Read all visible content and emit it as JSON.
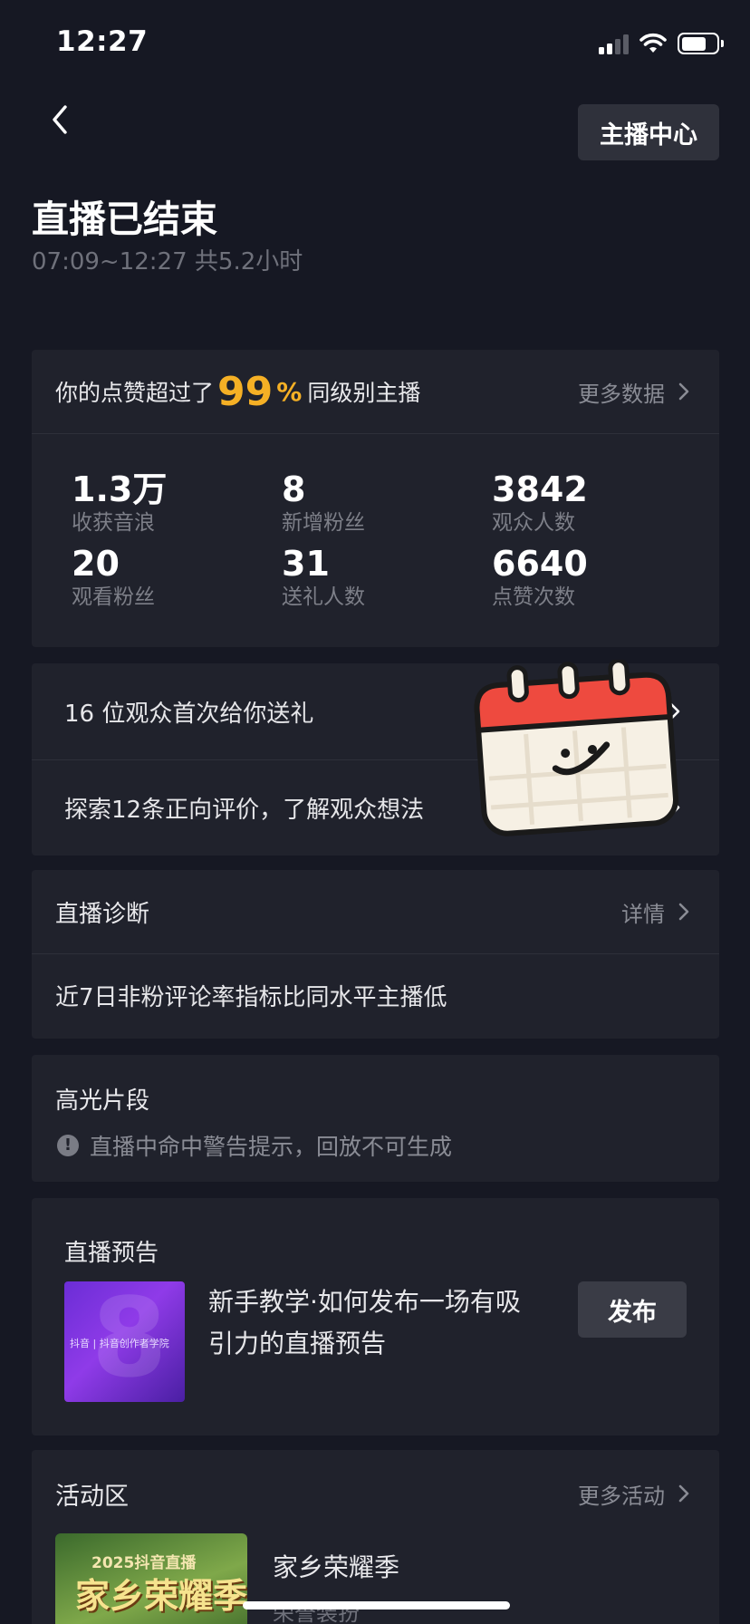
{
  "status_bar": {
    "time": "12:27"
  },
  "header": {
    "anchor_center_label": "主播中心",
    "title": "直播已结束",
    "subtitle": "07:09~12:27 共5.2小时"
  },
  "summary": {
    "beat_prefix": "你的点赞超过了",
    "beat_value": "99",
    "beat_unit": "%",
    "beat_suffix": "同级别主播",
    "more_label": "更多数据",
    "stats": [
      {
        "value": "1.3万",
        "label": "收获音浪"
      },
      {
        "value": "8",
        "label": "新增粉丝"
      },
      {
        "value": "3842",
        "label": "观众人数"
      },
      {
        "value": "20",
        "label": "观看粉丝"
      },
      {
        "value": "31",
        "label": "送礼人数"
      },
      {
        "value": "6640",
        "label": "点赞次数"
      }
    ]
  },
  "audience": {
    "first_gift": "16 位观众首次给你送礼",
    "reviews": "探索12条正向评价，了解观众想法"
  },
  "diagnosis": {
    "title": "直播诊断",
    "detail_label": "详情",
    "text": "近7日非粉评论率指标比同水平主播低"
  },
  "highlights": {
    "title": "高光片段",
    "warning": "直播中命中警告提示，回放不可生成"
  },
  "preview": {
    "title": "直播预告",
    "description": "新手教学·如何发布一场有吸引力的直播预告",
    "publish_label": "发布",
    "thumb_caption": "抖音 | 抖音创作者学院"
  },
  "activities": {
    "title": "活动区",
    "more_label": "更多活动",
    "item_name": "家乡荣耀季",
    "item_sub": "荣誉装扮",
    "thumb_year": "2025抖音直播",
    "thumb_title": "家乡荣耀季"
  },
  "colors": {
    "background": "#161823",
    "card": "#20222c",
    "accent": "#f5b025"
  }
}
